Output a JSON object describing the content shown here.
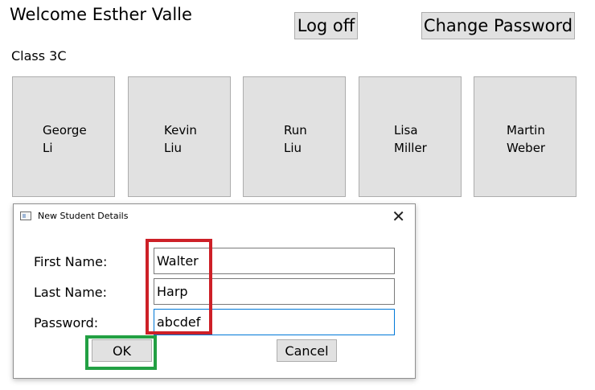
{
  "header": {
    "welcome": "Welcome Esther Valle",
    "logoff_label": "Log off",
    "change_password_label": "Change Password"
  },
  "class_label": "Class 3C",
  "students": [
    {
      "first": "George",
      "last": "Li"
    },
    {
      "first": "Kevin",
      "last": "Liu"
    },
    {
      "first": "Run",
      "last": "Liu"
    },
    {
      "first": "Lisa",
      "last": "Miller"
    },
    {
      "first": "Martin",
      "last": "Weber"
    }
  ],
  "dialog": {
    "title": "New Student Details",
    "close_glyph": "✕",
    "first_name_label": "First Name:",
    "first_name_value": "Walter",
    "last_name_label": "Last Name:",
    "last_name_value": "Harp",
    "password_label": "Password:",
    "password_value": "abcdef",
    "ok_label": "OK",
    "cancel_label": "Cancel"
  },
  "colors": {
    "button_face": "#e1e1e1",
    "button_border": "#adadad",
    "focus_border": "#0078d7",
    "highlight_red": "#cd2027",
    "highlight_green": "#22a043"
  },
  "icons": {
    "window_icon": "window-icon",
    "close": "close-icon"
  }
}
